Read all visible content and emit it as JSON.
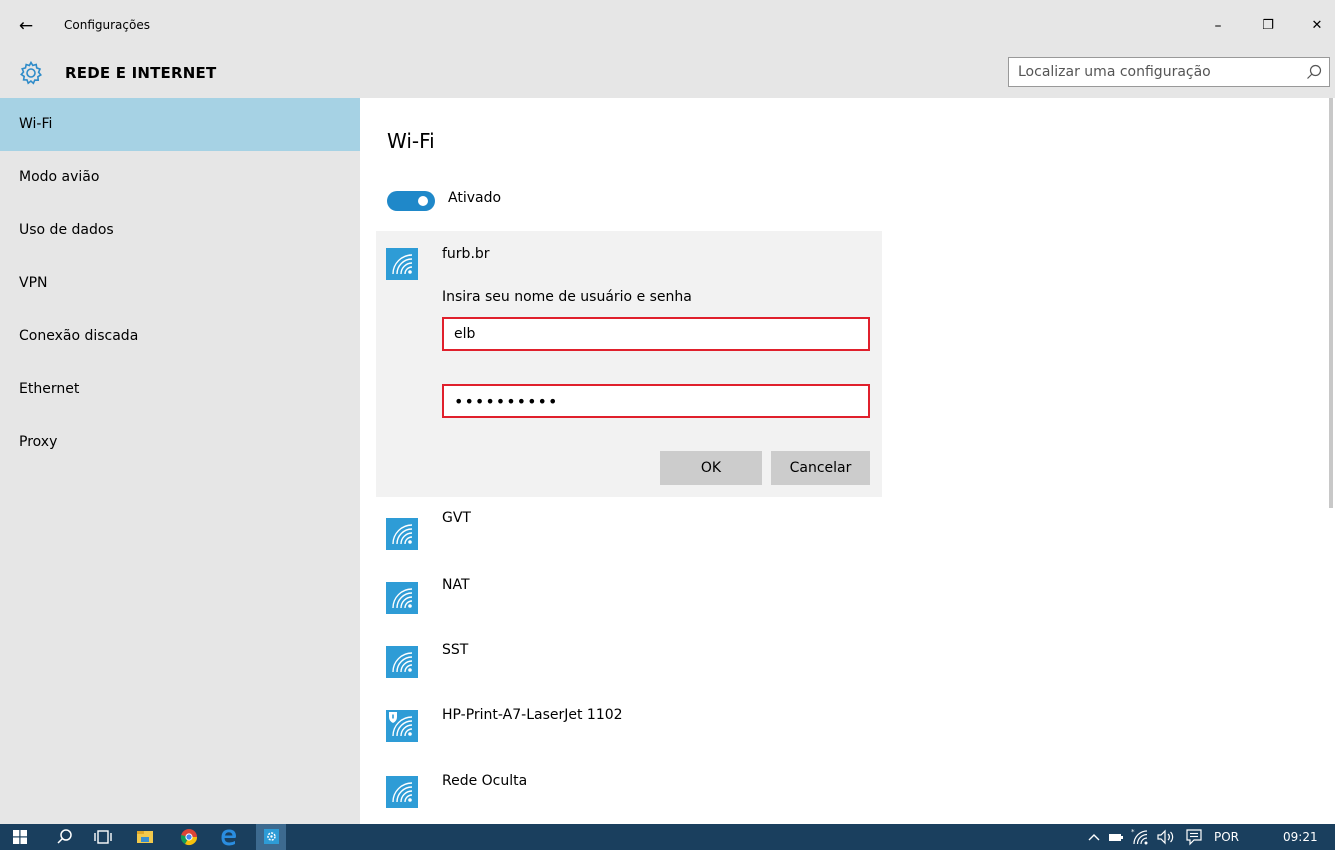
{
  "window": {
    "title": "Configurações",
    "back_icon": "arrow-left-icon",
    "controls": [
      "minimize-icon",
      "restore-icon",
      "close-icon"
    ],
    "glyphs": {
      "back": "←",
      "minimize": "–",
      "restore": "❐",
      "close": "✕"
    }
  },
  "header": {
    "section": "REDE E INTERNET",
    "icon": "gear-icon",
    "search_placeholder": "Localizar uma configuração",
    "search_value": ""
  },
  "sidebar": {
    "items": [
      {
        "label": "Wi-Fi",
        "active": true
      },
      {
        "label": "Modo avião",
        "active": false
      },
      {
        "label": "Uso de dados",
        "active": false
      },
      {
        "label": "VPN",
        "active": false
      },
      {
        "label": "Conexão discada",
        "active": false
      },
      {
        "label": "Ethernet",
        "active": false
      },
      {
        "label": "Proxy",
        "active": false
      }
    ]
  },
  "main": {
    "title": "Wi-Fi",
    "toggle": {
      "state": true,
      "label": "Ativado"
    },
    "connecting": {
      "name": "furb.br",
      "prompt": "Insira seu nome de usuário e senha",
      "username": "elb",
      "password": "••••••••••",
      "ok_label": "OK",
      "cancel_label": "Cancelar"
    },
    "networks": [
      {
        "name": "GVT",
        "secured": false
      },
      {
        "name": "NAT",
        "secured": false
      },
      {
        "name": "SST",
        "secured": false
      },
      {
        "name": "HP-Print-A7-LaserJet 1102",
        "secured": true
      },
      {
        "name": "Rede Oculta",
        "secured": false
      }
    ]
  },
  "taskbar": {
    "icons": [
      "windows-start-icon",
      "search-icon",
      "task-view-icon",
      "file-explorer-icon",
      "chrome-icon",
      "edge-icon",
      "settings-icon"
    ],
    "tray": {
      "language": "POR",
      "time": "09:21"
    }
  },
  "colors": {
    "accent": "#1f88c9",
    "wifi_tile": "#2e9cd6",
    "sidebar_selected": "#a6d2e4",
    "error_border": "#e0202c",
    "taskbar": "#1a3f5e"
  }
}
